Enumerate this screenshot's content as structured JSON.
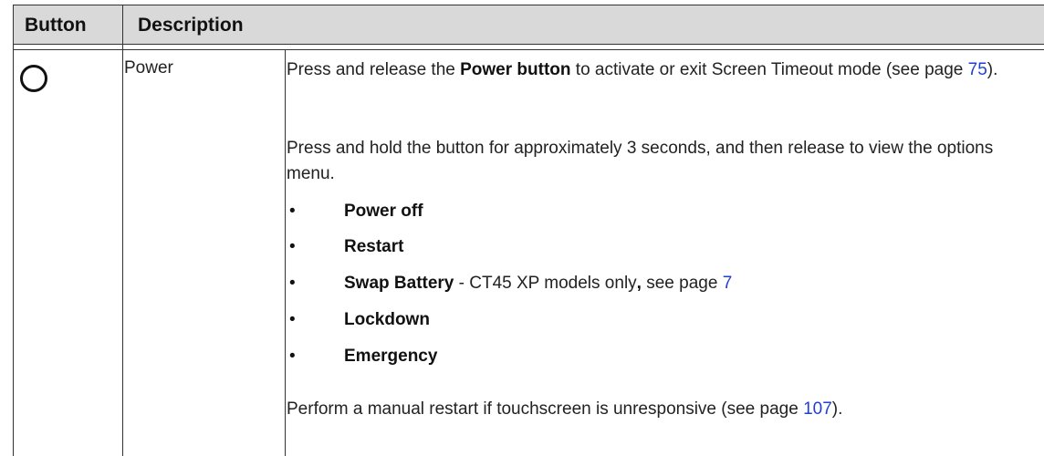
{
  "header": {
    "col1": "Button",
    "col2": "Description"
  },
  "row": {
    "icon": "power-circle-icon",
    "name": "Power",
    "p1": {
      "pre": "Press and release the ",
      "bold": "Power button",
      "mid": " to activate or exit Screen Timeout mode (see page ",
      "link": "75",
      "post": ")."
    },
    "p2": "Press and hold the button for approximately 3 seconds, and then release to view the options menu.",
    "bullet_char": "•",
    "bullets": [
      {
        "bold": "Power off"
      },
      {
        "bold": "Restart"
      },
      {
        "bold": "Swap Battery",
        "rest1": " - CT45 XP models only",
        "comma": ",",
        "rest2": " see page ",
        "link": "7"
      },
      {
        "bold": "Lockdown"
      },
      {
        "bold": "Emergency"
      }
    ],
    "p3": {
      "pre": "Perform a manual restart if touchscreen is unresponsive (see page ",
      "link": "107",
      "post": ")."
    }
  }
}
